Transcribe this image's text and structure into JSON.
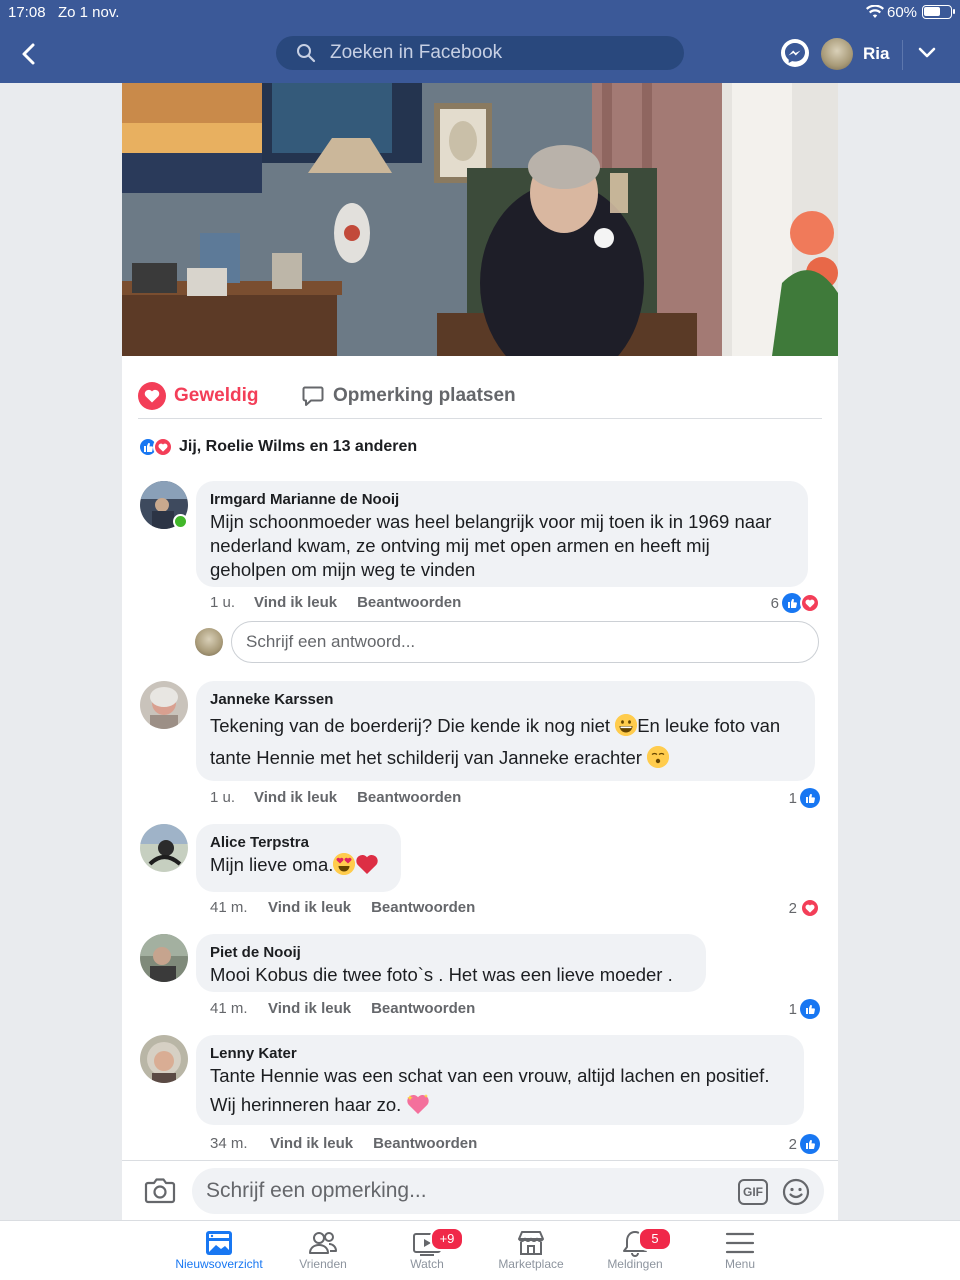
{
  "status_bar": {
    "time": "17:08",
    "date": "Zo 1 nov.",
    "battery": "60%"
  },
  "header": {
    "search_placeholder": "Zoeken in Facebook",
    "user_name": "Ria"
  },
  "post": {
    "love_label": "Geweldig",
    "comment_label": "Opmerking plaatsen",
    "reactions_text": "Jij, Roelie Wilms en 13 anderen"
  },
  "comments": [
    {
      "author": "Irmgard Marianne de Nooij",
      "text_lines": [
        "Mijn schoonmoeder was heel belangrijk voor mij toen ik in 1969 naar",
        "nederland kwam, ze ontving mij met open armen en heeft mij",
        "geholpen om mijn weg te vinden"
      ],
      "time": "1 u.",
      "count": "6",
      "reactions": [
        "like",
        "love"
      ]
    },
    {
      "author": "Janneke Karssen",
      "text_line1a": "Tekening van de boerderij? Die kende ik nog niet ",
      "text_line1b": "En leuke foto van",
      "text_line2": "tante Hennie met het schilderij van Janneke erachter ",
      "time": "1 u.",
      "count": "1",
      "reactions": [
        "like"
      ]
    },
    {
      "author": "Alice Terpstra",
      "text": "Mijn lieve oma.",
      "time": "41 m.",
      "count": "2",
      "reactions": [
        "love"
      ]
    },
    {
      "author": "Piet de Nooij",
      "text": "Mooi Kobus die twee foto`s . Het was een lieve moeder .",
      "time": "41 m.",
      "count": "1",
      "reactions": [
        "like"
      ]
    },
    {
      "author": "Lenny Kater",
      "text_line1": "Tante Hennie was een schat van een vrouw, altijd lachen en positief.",
      "text_line2": "Wij herinneren haar zo. ",
      "time": "34 m.",
      "count": "2",
      "reactions": [
        "like"
      ]
    }
  ],
  "comment_actions": {
    "like": "Vind ik leuk",
    "reply": "Beantwoorden"
  },
  "reply_placeholder": "Schrijf een antwoord...",
  "composer": {
    "placeholder": "Schrijf een opmerking...",
    "gif": "GIF"
  },
  "bottom_nav": [
    {
      "label": "Nieuwsoverzicht",
      "icon": "news-feed-icon",
      "active": true
    },
    {
      "label": "Vrienden",
      "icon": "friends-icon"
    },
    {
      "label": "Watch",
      "icon": "watch-icon",
      "badge": "+9"
    },
    {
      "label": "Marketplace",
      "icon": "marketplace-icon"
    },
    {
      "label": "Meldingen",
      "icon": "bell-icon",
      "badge": "5"
    },
    {
      "label": "Menu",
      "icon": "menu-icon"
    }
  ],
  "colors": {
    "brand": "#3b5998",
    "love": "#f33e58",
    "like": "#1877f2"
  }
}
